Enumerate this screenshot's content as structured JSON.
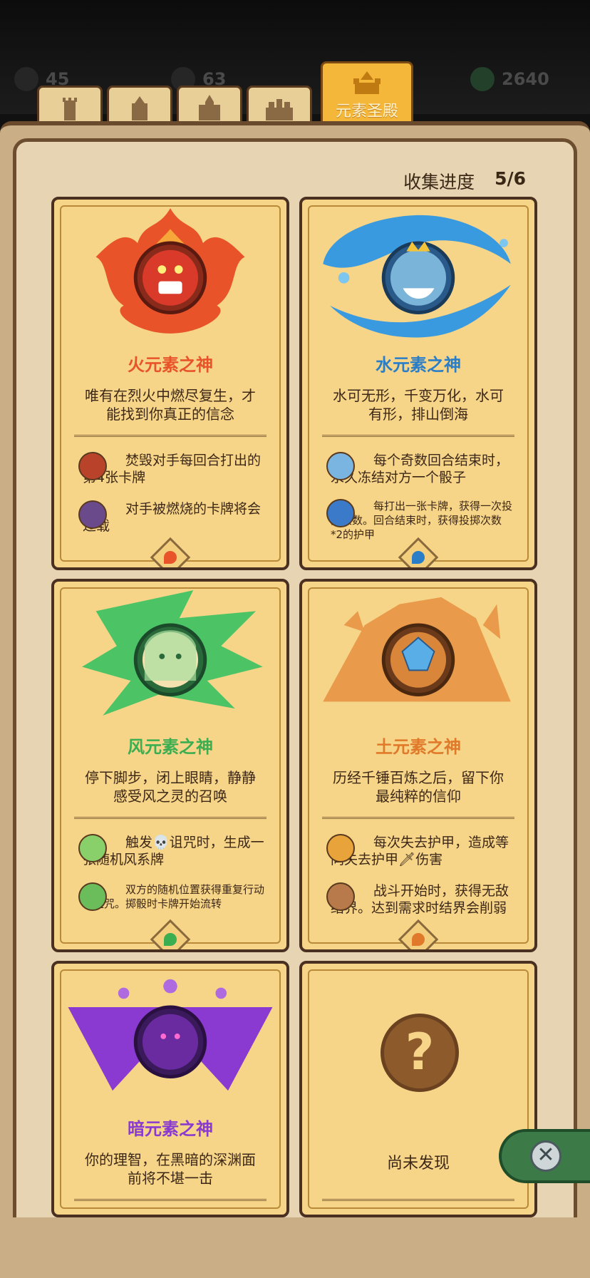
{
  "topbar": {
    "stat_left": "45",
    "stat_mid": "63",
    "stat_right": "2640"
  },
  "tabs": [
    {
      "icon": "tower-icon"
    },
    {
      "icon": "castle-icon"
    },
    {
      "icon": "fortress-icon"
    },
    {
      "icon": "palace-icon"
    },
    {
      "icon": "temple-icon",
      "label": "元素圣殿",
      "active": true
    }
  ],
  "collection": {
    "label": "收集进度",
    "count": "5/6"
  },
  "cards": [
    {
      "name": "火元素之神",
      "color": "#e8532a",
      "desc": "唯有在烈火中燃尽复生，才能找到你真正的信念",
      "abilities": [
        {
          "text": "焚毁对手每回合打出的第4张卡牌"
        },
        {
          "text": "对手被燃烧的卡牌将会过载"
        }
      ]
    },
    {
      "name": "水元素之神",
      "color": "#2a7ec8",
      "desc": "水可无形，千变万化，水可有形，排山倒海",
      "abilities": [
        {
          "text": "每个奇数回合结束时，永久冻结对方一个骰子"
        },
        {
          "text": "每打出一张卡牌，获得一次投掷次数。回合结束时，获得投掷次数*2的护甲"
        }
      ]
    },
    {
      "name": "风元素之神",
      "color": "#3cae52",
      "desc": "停下脚步，闭上眼睛，静静感受风之灵的召唤",
      "abilities": [
        {
          "text": "触发💀诅咒时，生成一张随机风系牌"
        },
        {
          "text": "双方的随机位置获得重复行动和诅咒。掷骰时卡牌开始流转"
        }
      ]
    },
    {
      "name": "土元素之神",
      "color": "#e07a2a",
      "desc": "历经千锤百炼之后，留下你最纯粹的信仰",
      "abilities": [
        {
          "text": "每次失去护甲，造成等同失去护甲🗡伤害"
        },
        {
          "text": "战斗开始时，获得无敌结界。达到需求时结界会削弱"
        }
      ]
    },
    {
      "name": "暗元素之神",
      "color": "#8a3ad0",
      "desc": "你的理智，在黑暗的深渊面前将不堪一击"
    },
    {
      "status": "尚未发现"
    }
  ],
  "close_label": "✕"
}
